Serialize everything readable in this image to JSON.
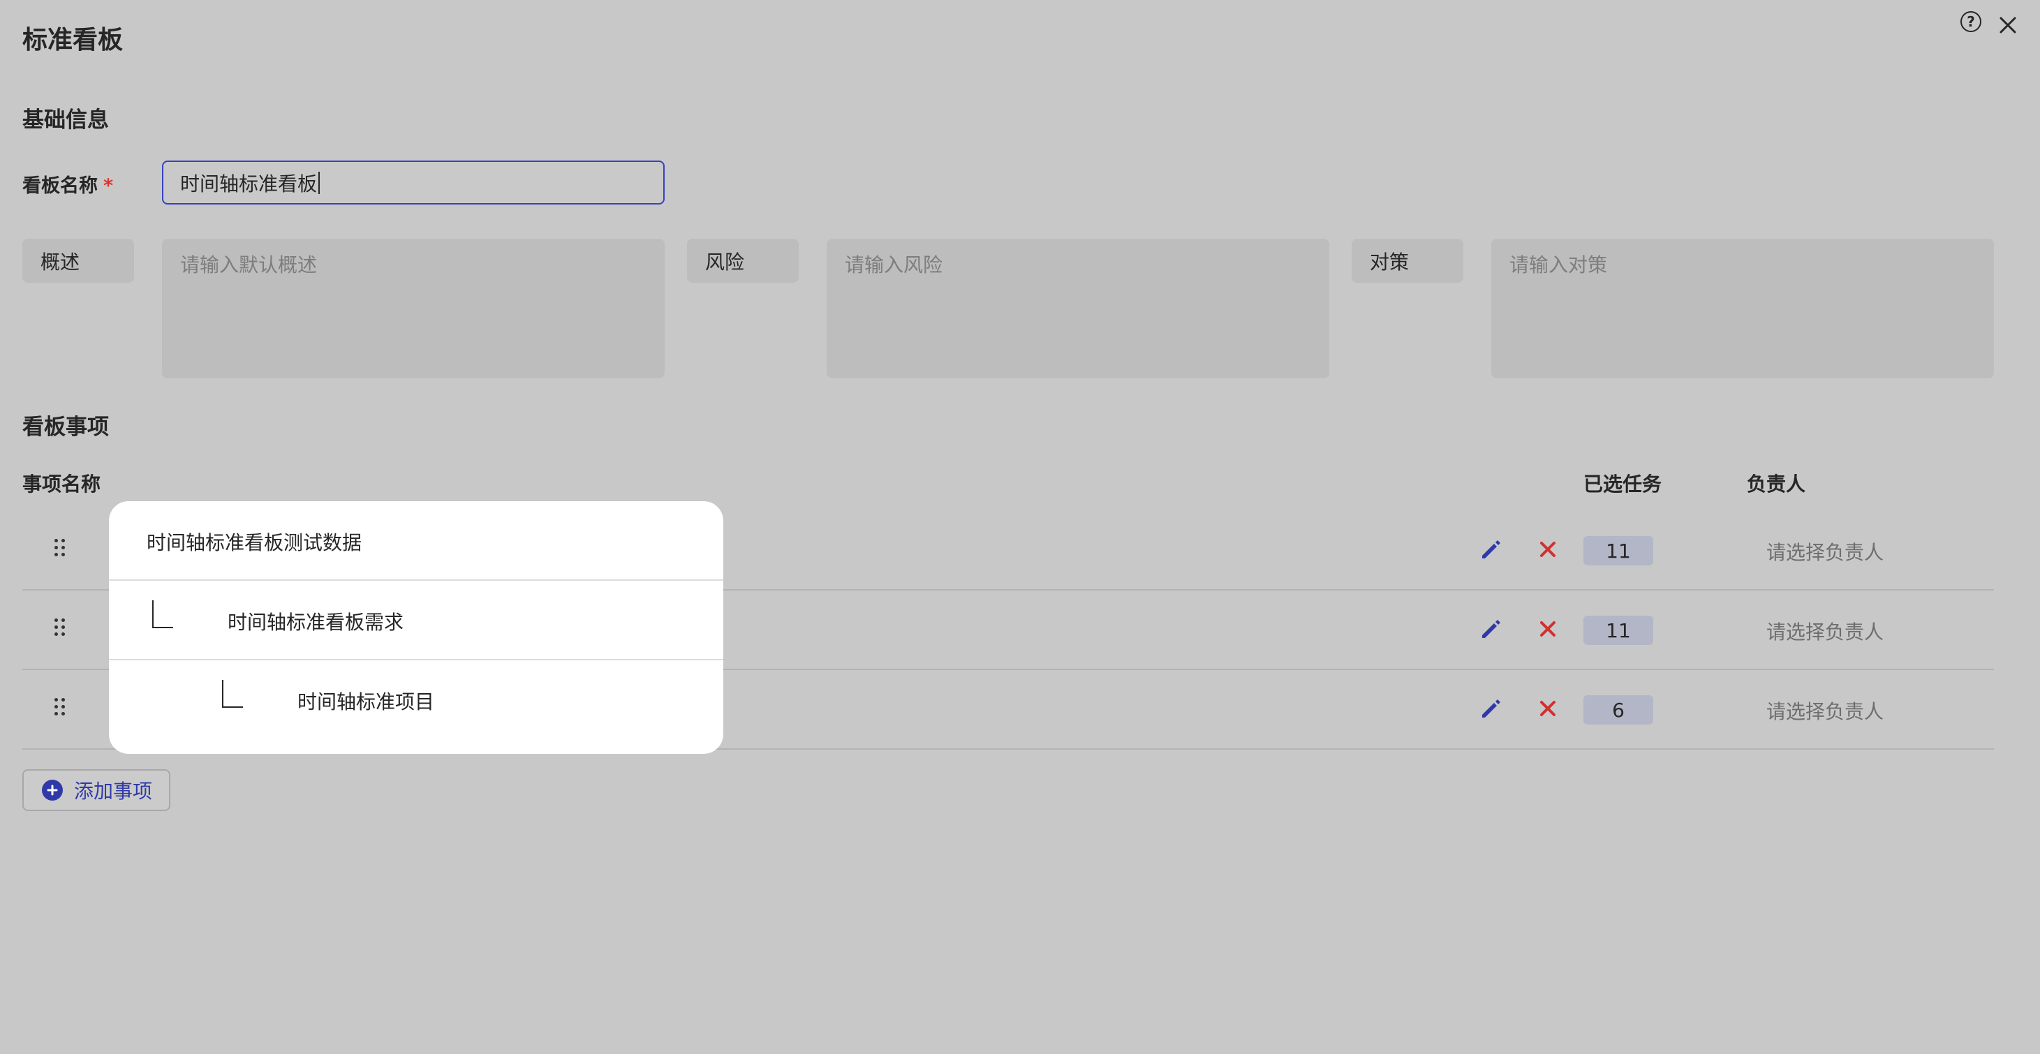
{
  "header": {
    "title": "标准看板"
  },
  "basic": {
    "section_title": "基础信息",
    "name_label": "看板名称",
    "required_mark": "*",
    "name_value": "时间轴标准看板"
  },
  "fields": {
    "summary_label": "概述",
    "summary_placeholder": "请输入默认概述",
    "risk_label": "风险",
    "risk_placeholder": "请输入风险",
    "measure_label": "对策",
    "measure_placeholder": "请输入对策"
  },
  "items": {
    "section_title": "看板事项",
    "columns": {
      "name": "事项名称",
      "selected_tasks": "已选任务",
      "owner": "负责人"
    },
    "rows": [
      {
        "name": "时间轴标准看板测试数据",
        "level": 0,
        "count": "11",
        "owner_placeholder": "请选择负责人"
      },
      {
        "name": "时间轴标准看板需求",
        "level": 1,
        "count": "11",
        "owner_placeholder": "请选择负责人"
      },
      {
        "name": "时间轴标准项目",
        "level": 2,
        "count": "6",
        "owner_placeholder": "请选择负责人"
      }
    ],
    "add_label": "添加事项"
  },
  "colors": {
    "accent": "#2f3aa8",
    "danger": "#d32f2f",
    "required": "#e03030"
  },
  "icons": [
    "help-icon",
    "close-icon",
    "drag-handle-icon",
    "edit-pencil-icon",
    "delete-x-icon",
    "plus-circle-icon",
    "tree-branch-icon"
  ]
}
